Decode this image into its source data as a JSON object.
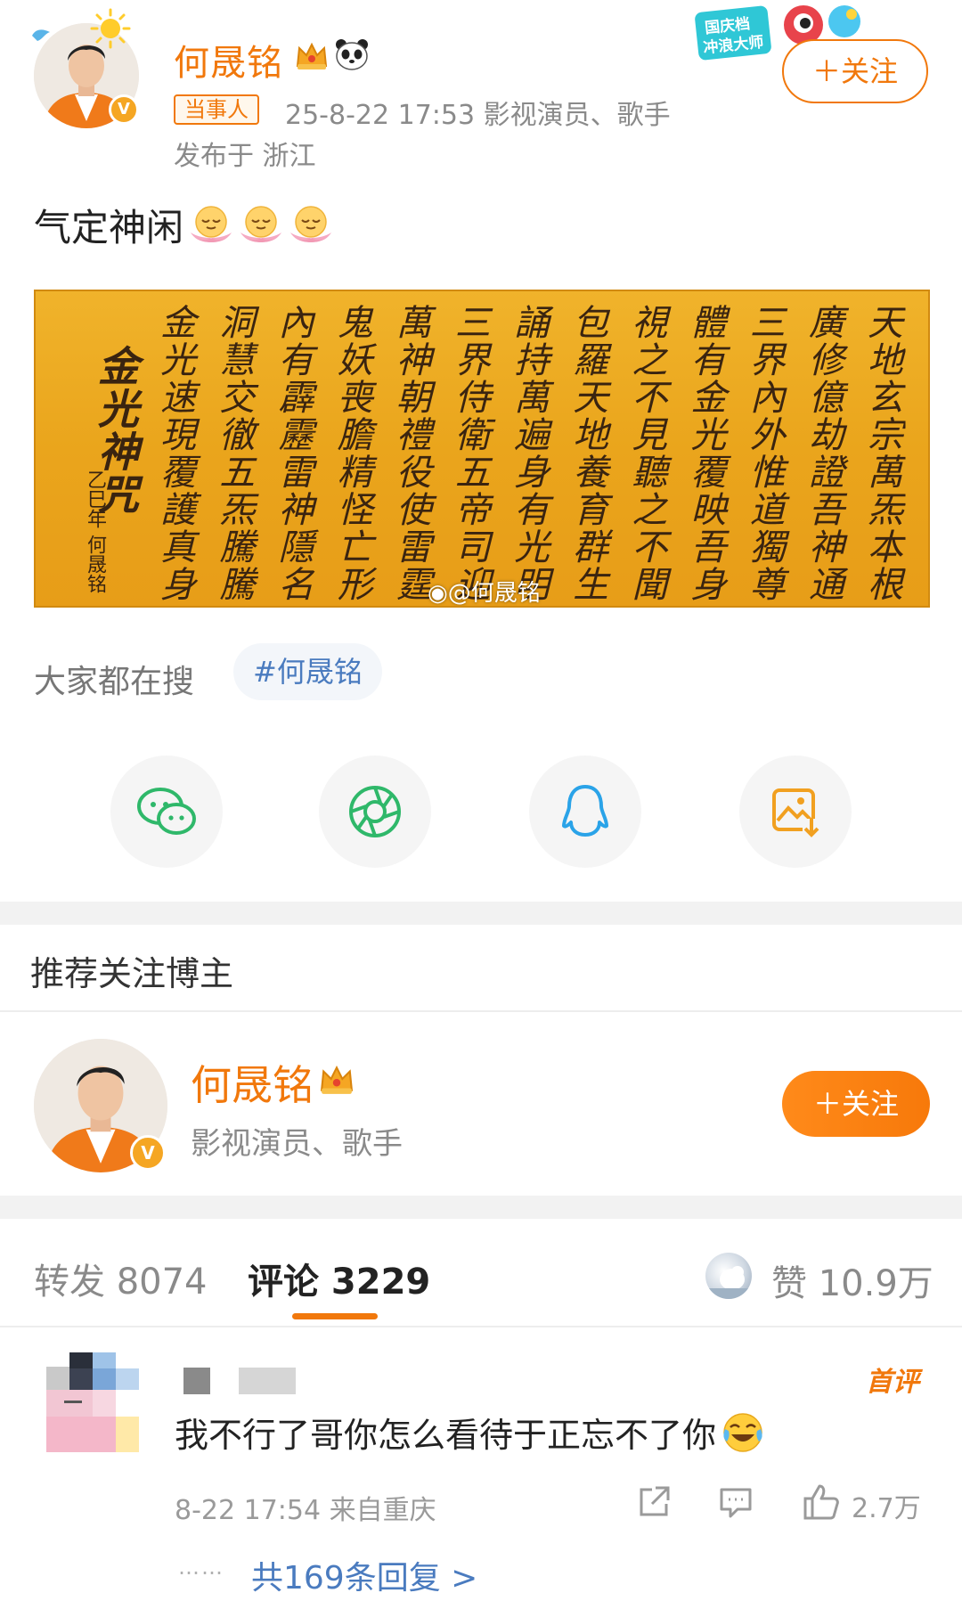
{
  "post": {
    "author_name": "何晟铭",
    "tag": "当事人",
    "meta": "25-8-22 17:53 影视演员、歌手",
    "location": "发布于 浙江",
    "follow_label": "＋关注",
    "promo_badge_text": "国庆档 冲浪大师",
    "text": "气定神闲",
    "image_watermark": "@何晟铭",
    "calligraphy_columns": [
      "天地玄宗萬炁本根",
      "廣修億劫證吾神通",
      "三界內外惟道獨尊",
      "體有金光覆映吾身",
      "視之不見聽之不聞",
      "包羅天地養育群生",
      "誦持萬遍身有光明",
      "三界侍衛五帝司迎",
      "萬神朝禮役使雷霆",
      "鬼妖喪膽精怪亡形",
      "內有霹靂雷神隱名",
      "洞慧交徹五炁騰騰",
      "金光速現覆護真身",
      "金光神咒"
    ]
  },
  "search": {
    "label": "大家都在搜",
    "chip": "#何晟铭"
  },
  "share": [
    {
      "name": "wechat-icon"
    },
    {
      "name": "moments-icon"
    },
    {
      "name": "qq-icon"
    },
    {
      "name": "save-image-icon"
    }
  ],
  "recommend": {
    "title": "推荐关注博主",
    "name": "何晟铭",
    "desc": "影视演员、歌手",
    "follow_label": "＋关注"
  },
  "stats": {
    "repost": "转发 8074",
    "comment": "评论 3229",
    "like": "赞 10.9万"
  },
  "comment": {
    "first_badge": "首评",
    "text": "我不行了哥你怎么看待于正忘不了你",
    "meta": "8-22 17:54 来自重庆",
    "likes": "2.7万",
    "replies": "共169条回复 >",
    "dots": "……"
  },
  "colors": {
    "accent": "#f1780c",
    "link": "#4a7bbf",
    "muted": "#8a8a8a",
    "calligraphy_bg": "#eaa51c"
  }
}
